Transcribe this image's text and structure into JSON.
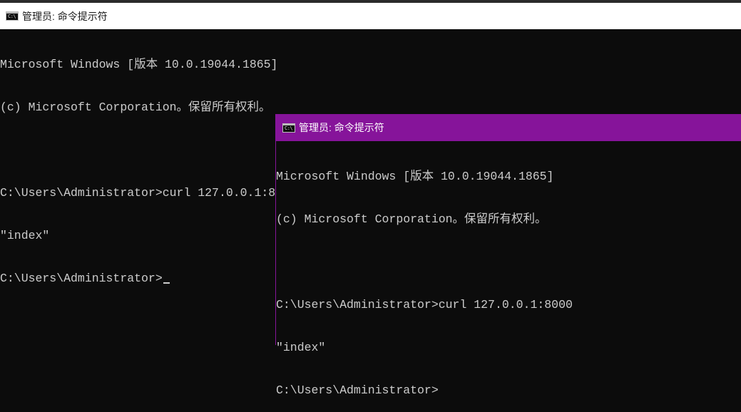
{
  "window_back": {
    "title": "管理员: 命令提示符",
    "lines": [
      "Microsoft Windows [版本 10.0.19044.1865]",
      "(c) Microsoft Corporation。保留所有权利。",
      "",
      "C:\\Users\\Administrator>curl 127.0.0.1:8000",
      "\"index\"",
      "C:\\Users\\Administrator>"
    ]
  },
  "window_front": {
    "title": "管理员: 命令提示符",
    "lines": [
      "Microsoft Windows [版本 10.0.19044.1865]",
      "(c) Microsoft Corporation。保留所有权利。",
      "",
      "C:\\Users\\Administrator>curl 127.0.0.1:8000",
      "\"index\"",
      "C:\\Users\\Administrator>"
    ]
  },
  "icons": {
    "window_icon": "cmd-icon"
  },
  "colors": {
    "front_titlebar": "#86149a",
    "back_titlebar": "#ffffff",
    "console_bg": "#0c0c0c",
    "console_text": "#cccccc"
  }
}
